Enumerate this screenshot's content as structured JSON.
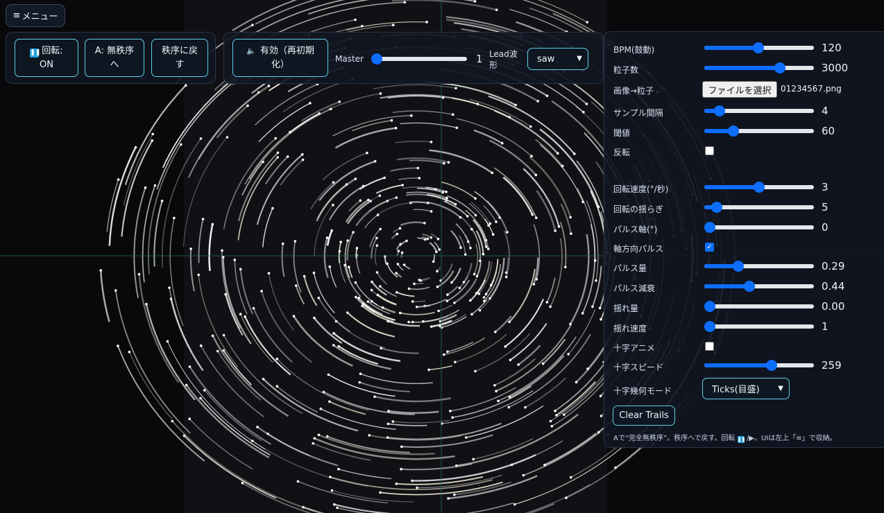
{
  "menu_button": {
    "icon": "hamburger-icon",
    "glyph": "≡",
    "label": "メニュー"
  },
  "transport": {
    "rotate_line1": "回転:",
    "rotate_line2": "ON",
    "rotate_icon": "pause-icon",
    "chaos_line1": "A: 無秩序",
    "chaos_line2": "へ",
    "order_line1": "秩序に戻",
    "order_line2": "す"
  },
  "audio": {
    "enable_icon": "speaker-icon",
    "enable_line1": "有効（再初期",
    "enable_line2": "化）",
    "master_label": "Master",
    "master_value": "1",
    "master_level": 0.0,
    "lead_label_1": "Lead波",
    "lead_label_2": "形",
    "lead_selected": "saw"
  },
  "settings": {
    "bpm": {
      "label": "BPM(鼓動)",
      "value": "120",
      "level": 0.49
    },
    "particles": {
      "label": "粒子数",
      "value": "3000",
      "level": 0.71
    },
    "image": {
      "label": "画像→粒子",
      "button": "ファイルを選択",
      "filename": "01234567.png"
    },
    "sample": {
      "label": "サンプル間隔",
      "value": "4",
      "level": 0.1
    },
    "threshold": {
      "label": "閾値",
      "value": "60",
      "level": 0.24
    },
    "invert": {
      "label": "反転",
      "checked": false
    },
    "rot_speed": {
      "label": "回転速度(°/秒)",
      "value": "3",
      "level": 0.5
    },
    "rot_wobble": {
      "label": "回転の揺らぎ",
      "value": "5",
      "level": 0.07
    },
    "pulse_axis": {
      "label": "パルス軸(°)",
      "value": "0",
      "level": 0.0
    },
    "axial_pulse": {
      "label": "軸方向パルス",
      "checked": true
    },
    "pulse_amount": {
      "label": "パルス量",
      "value": "0.29",
      "level": 0.29
    },
    "pulse_decay": {
      "label": "パルス減衰",
      "value": "0.44",
      "level": 0.4
    },
    "shake_amount": {
      "label": "揺れ量",
      "value": "0.00",
      "level": 0.0
    },
    "shake_speed": {
      "label": "揺れ速度",
      "value": "1",
      "level": 0.0
    },
    "cross_anim": {
      "label": "十字アニメ",
      "checked": false
    },
    "cross_speed": {
      "label": "十字スピード",
      "value": "259",
      "level": 0.63
    },
    "cross_mode": {
      "label": "十字幾何モード",
      "selected": "Ticks(目盛)"
    },
    "clear_trails": "Clear Trails",
    "footnote_a": "Aで“完全無秩序”。秩序へで戻す。回転",
    "footnote_b": "/▶。UIは左上「≡」で収納。"
  },
  "colors": {
    "accent": "#0d6efd",
    "button_border": "#5fd0e6",
    "panel": "#101622",
    "crosshair": "#1f6b58"
  }
}
